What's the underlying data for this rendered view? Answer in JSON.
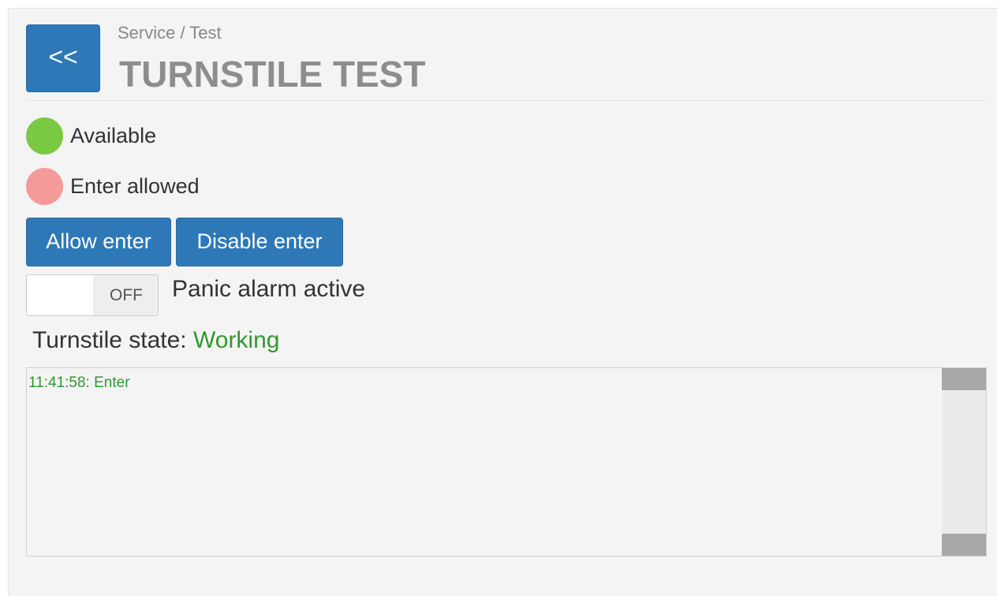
{
  "header": {
    "back_label": "<<",
    "breadcrumb": "Service / Test",
    "title": "TURNSTILE TEST"
  },
  "indicators": [
    {
      "label": "Available",
      "color": "#7ac943"
    },
    {
      "label": "Enter allowed",
      "color": "#f59a9a"
    }
  ],
  "actions": {
    "allow_label": "Allow enter",
    "disable_label": "Disable enter"
  },
  "panic": {
    "toggle_state": "OFF",
    "label": "Panic alarm active"
  },
  "state": {
    "label": "Turnstile state:",
    "value": "Working"
  },
  "log": {
    "entries": [
      "11:41:58: Enter"
    ]
  },
  "colors": {
    "accent": "#2e78b7",
    "success_text": "#2f9a2f"
  }
}
